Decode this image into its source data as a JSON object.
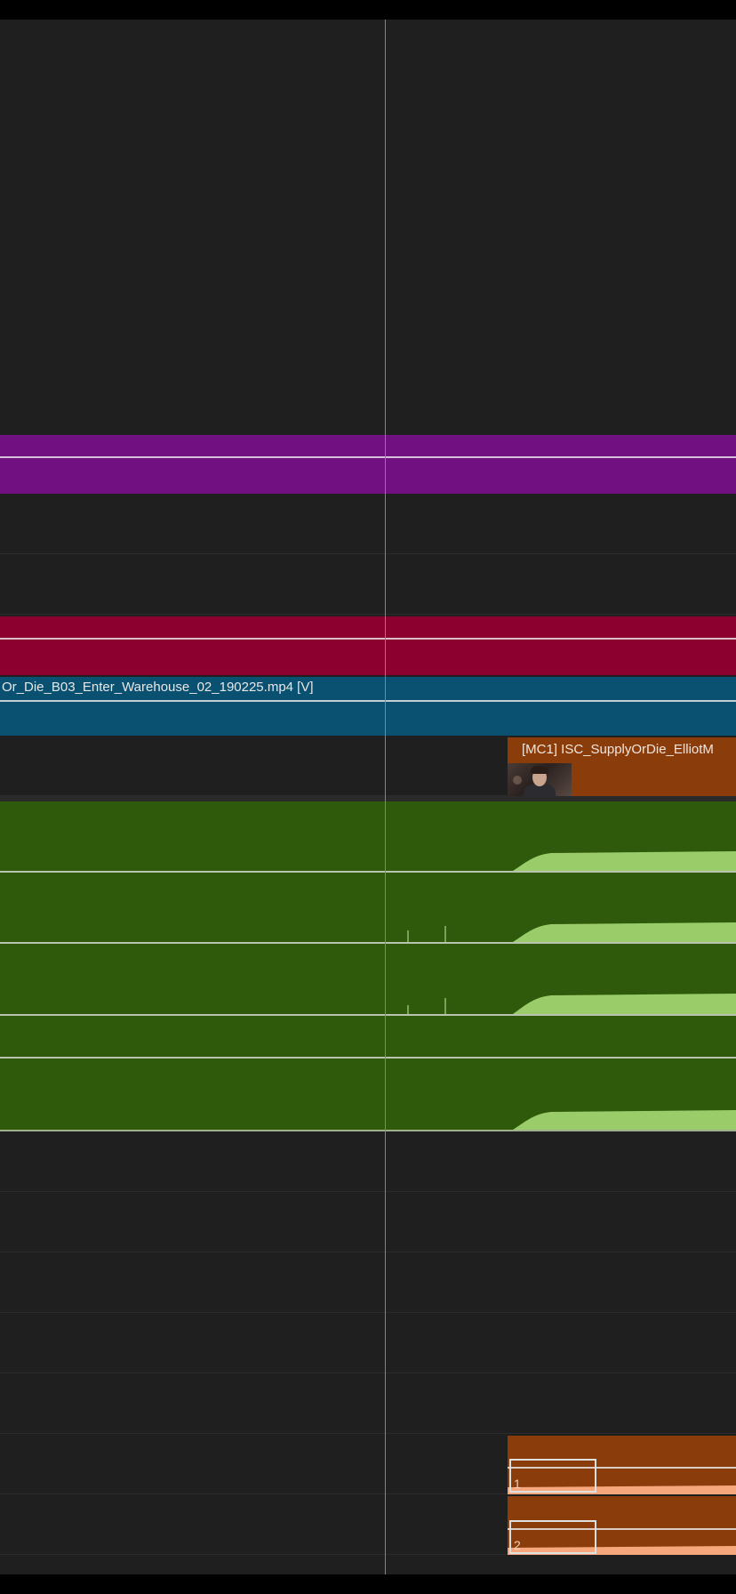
{
  "timeline": {
    "clips": {
      "video_main": {
        "label": "Or_Die_B03_Enter_Warehouse_02_190225.mp4 [V]",
        "color": "#0a5070"
      },
      "multicam": {
        "label": "[MC1] ISC_SupplyOrDie_ElliotM",
        "color": "#8a3c0b"
      },
      "adjustment_purple": {
        "color": "#711080"
      },
      "adjustment_red": {
        "color": "#8c0030"
      }
    },
    "audio_effects": [
      {
        "label": "1"
      },
      {
        "label": "2"
      }
    ],
    "colors": {
      "audio_track": "#2f5a0c",
      "waveform": "#9acd6a",
      "waveform_orange": "#f6a77c",
      "playhead": "#4a90e2"
    }
  }
}
